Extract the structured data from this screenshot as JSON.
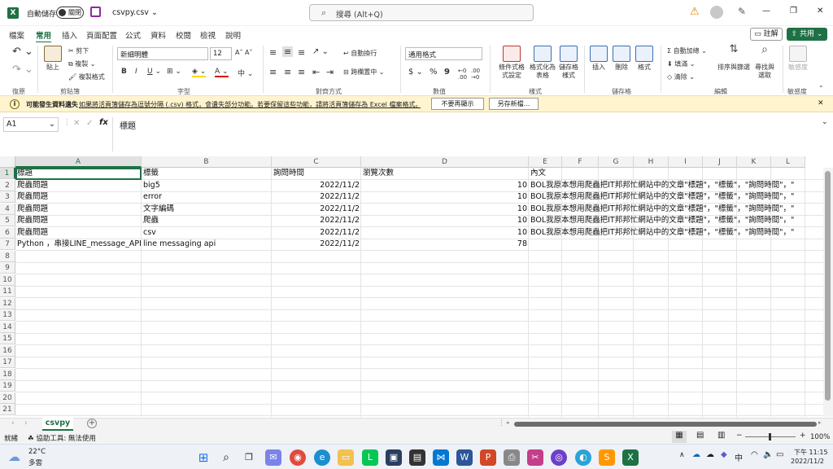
{
  "title_bar": {
    "app_letter": "X",
    "autosave_label": "自動儲存",
    "autosave_state": "關閉",
    "file_name": "csvpy.csv",
    "search_placeholder": "搜尋 (Alt+Q)",
    "warning_glyph": "⚠",
    "minimize_glyph": "—",
    "restore_glyph": "❐",
    "close_glyph": "✕"
  },
  "menu": {
    "tabs": [
      "檔案",
      "常用",
      "插入",
      "頁面配置",
      "公式",
      "資料",
      "校閱",
      "檢視",
      "說明"
    ],
    "active_tab": "常用",
    "comment_label": "註解",
    "share_label": "共用"
  },
  "ribbon": {
    "undo_group": "復原",
    "clipboard": {
      "paste": "貼上",
      "cut": "剪下",
      "copy": "複製",
      "format_painter": "複製格式",
      "group": "剪貼簿"
    },
    "font": {
      "name": "新細明體",
      "size": "12",
      "bold": "B",
      "italic": "I",
      "underline": "U",
      "group": "字型"
    },
    "alignment": {
      "wrap": "自動換行",
      "merge": "跨欄置中",
      "group": "對齊方式"
    },
    "number": {
      "format": "通用格式",
      "currency": "$",
      "percent": "%",
      "comma": "9",
      "group": "數值"
    },
    "styles": {
      "conditional": "條件式格式設定",
      "table": "格式化為表格",
      "cell": "儲存格樣式",
      "group": "樣式"
    },
    "cells": {
      "insert": "插入",
      "delete": "刪除",
      "format": "格式",
      "group": "儲存格"
    },
    "editing": {
      "autosum": "自動加總",
      "fill": "填滿",
      "clear": "清除",
      "sort": "排序與篩選",
      "find": "尋找與選取",
      "group": "編輯"
    },
    "sensitivity": {
      "label": "敏感度",
      "group": "敏感度"
    }
  },
  "info_bar": {
    "icon": "i",
    "prefix": "可能發生資料遺失",
    "message": "如果將活頁簿儲存為逗號分隔 (.csv) 格式，會遺失部分功能。若要保留這些功能，請將活頁簿儲存為 Excel 檔案格式。",
    "dont_show": "不要再顯示",
    "save_as": "另存新檔..."
  },
  "formula_bar": {
    "name_box": "A1",
    "fx": "fx",
    "content": "標題"
  },
  "grid": {
    "columns": [
      "A",
      "B",
      "C",
      "D",
      "E",
      "F",
      "G",
      "H",
      "I",
      "J",
      "K",
      "L"
    ],
    "rows": [
      "1",
      "2",
      "3",
      "4",
      "5",
      "6",
      "7",
      "8",
      "9",
      "10",
      "11",
      "12",
      "13",
      "14",
      "15",
      "16",
      "17",
      "18",
      "19",
      "20",
      "21"
    ],
    "cells": [
      [
        "標題",
        "標籤",
        "詢問時間",
        "瀏覽次數",
        "內文"
      ],
      [
        "爬蟲問題",
        "big5",
        "2022/11/2",
        "10",
        "BOL我原本想用爬蟲把IT邦邦忙網站中的文章\"標題\"，\"標籤\"，\"詢問時間\"，\""
      ],
      [
        "爬蟲問題",
        "error",
        "2022/11/2",
        "10",
        "BOL我原本想用爬蟲把IT邦邦忙網站中的文章\"標題\"，\"標籤\"，\"詢問時間\"，\""
      ],
      [
        "爬蟲問題",
        "文字編碼",
        "2022/11/2",
        "10",
        "BOL我原本想用爬蟲把IT邦邦忙網站中的文章\"標題\"，\"標籤\"，\"詢問時間\"，\""
      ],
      [
        "爬蟲問題",
        "爬蟲",
        "2022/11/2",
        "10",
        "BOL我原本想用爬蟲把IT邦邦忙網站中的文章\"標題\"，\"標籤\"，\"詢問時間\"，\""
      ],
      [
        "爬蟲問題",
        "csv",
        "2022/11/2",
        "10",
        "BOL我原本想用爬蟲把IT邦邦忙網站中的文章\"標題\"，\"標籤\"，\"詢問時間\"，\""
      ],
      [
        "Python ，串接LINE_message_API &",
        "line messaging api",
        "2022/11/2",
        "78",
        ""
      ]
    ]
  },
  "sheet_tabs": {
    "active": "csvpy",
    "add": "+"
  },
  "status_bar": {
    "ready": "就緒",
    "accessibility": "協助工具: 無法使用",
    "zoom": "100%"
  },
  "taskbar": {
    "weather_temp": "22°C",
    "weather_desc": "多雲",
    "ime": "中",
    "time": "下午 11:15",
    "date": "2022/11/2"
  }
}
